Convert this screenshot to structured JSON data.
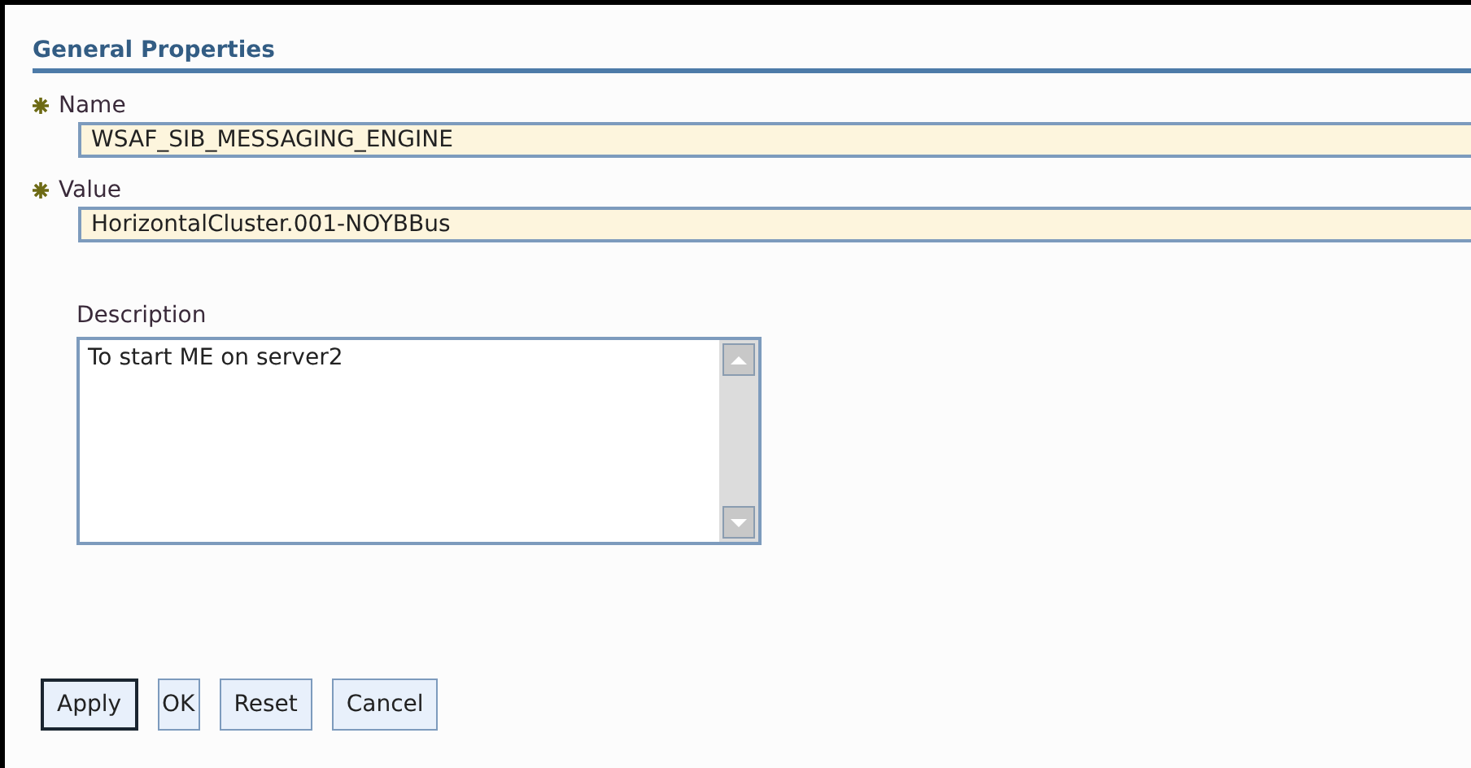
{
  "section": {
    "title": "General Properties"
  },
  "fields": [
    {
      "kind": "text",
      "label": "Name",
      "required": true,
      "value": "WSAF_SIB_MESSAGING_ENGINE"
    },
    {
      "kind": "text",
      "label": "Value",
      "required": true,
      "value": "HorizontalCluster.001-NOYBBus"
    },
    {
      "kind": "textarea",
      "label": "Description",
      "required": false,
      "value": "To start ME on server2"
    }
  ],
  "buttons": [
    {
      "label": "Apply",
      "default": true
    },
    {
      "label": "OK",
      "default": false
    },
    {
      "label": "Reset",
      "default": false
    },
    {
      "label": "Cancel",
      "default": false
    }
  ]
}
